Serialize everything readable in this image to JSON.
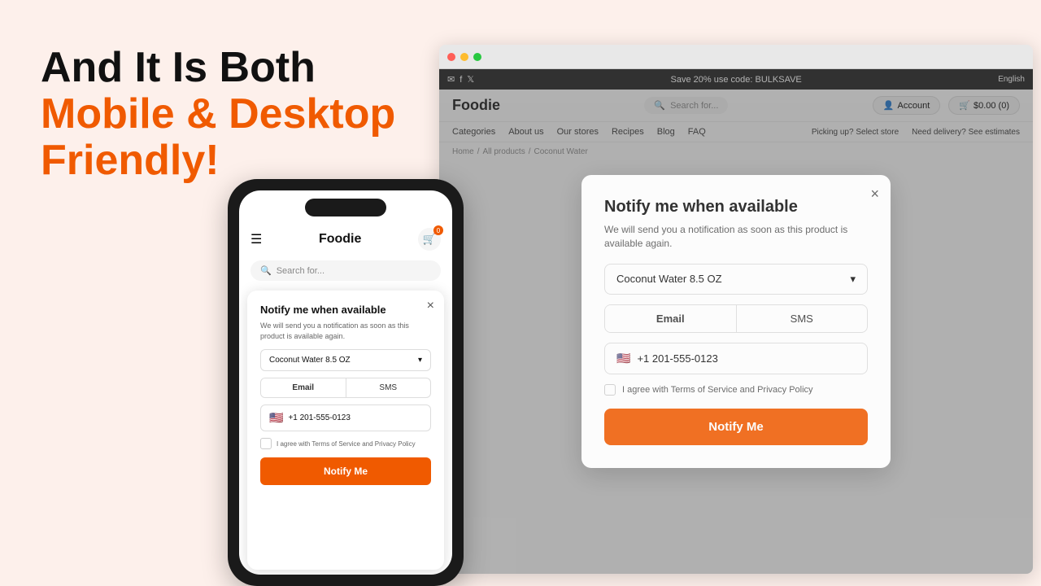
{
  "hero": {
    "line1": "And It Is Both",
    "line2": "Mobile & Desktop",
    "line3": "Friendly!"
  },
  "browser": {
    "banner": {
      "promo": "Save 20% use code: BULKSAVE",
      "lang": "English"
    },
    "nav": {
      "logo": "Foodie",
      "search_placeholder": "Search for...",
      "account_label": "Account",
      "cart_label": "$0.00 (0)"
    },
    "navlinks": [
      "Categories",
      "About us",
      "Our stores",
      "Recipes",
      "Blog",
      "FAQ"
    ],
    "pickup": "Picking up? Select store",
    "delivery": "Need delivery? See estimates",
    "breadcrumb": [
      "Home",
      "All products",
      "Coconut Water"
    ]
  },
  "desktop_modal": {
    "title": "Notify me when available",
    "subtitle": "We will send you a notification as soon as this product is available again.",
    "product": "Coconut Water 8.5 OZ",
    "tab_email": "Email",
    "tab_sms": "SMS",
    "phone_value": "+1 201-555-0123",
    "checkbox_label": "I agree with Terms of Service and Privacy Policy",
    "notify_btn": "Notify Me",
    "close_label": "×"
  },
  "phone_modal": {
    "title": "Notify me when available",
    "subtitle": "We will send you a notification as soon as this product is available again.",
    "product": "Coconut Water 8.5 OZ",
    "tab_email": "Email",
    "tab_sms": "SMS",
    "phone_value": "+1 201-555-0123",
    "checkbox_label": "I agree with Terms of Service and Privacy Policy",
    "notify_btn": "Notify Me",
    "close_label": "×"
  },
  "phone": {
    "logo": "Foodie",
    "search_placeholder": "Search for...",
    "hamburger": "☰",
    "cart_count": "0"
  }
}
